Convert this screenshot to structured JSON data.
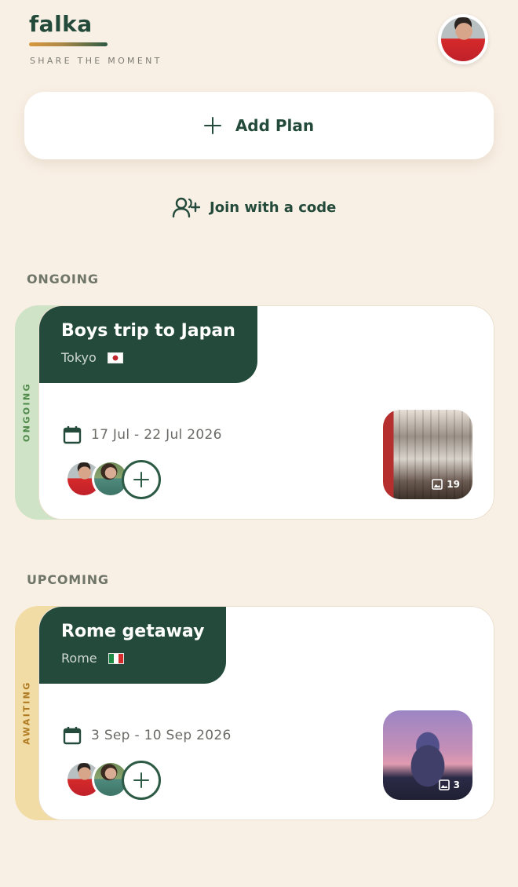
{
  "app": {
    "logo": "falka",
    "tagline": "SHARE THE MOMENT"
  },
  "actions": {
    "add_plan_label": "Add Plan",
    "join_label": "Join with a code"
  },
  "sections": {
    "ongoing_heading": "ONGOING",
    "upcoming_heading": "UPCOMING"
  },
  "plans": [
    {
      "status": "ONGOING",
      "status_color": "#cfe3c6",
      "status_text_color": "#4f8a4a",
      "title": "Boys trip to Japan",
      "location": "Tokyo",
      "flag": "japan-flag",
      "dates": "17 Jul - 22 Jul 2026",
      "photo_count": "19"
    },
    {
      "status": "AWAITING",
      "status_color": "#f0dca4",
      "status_text_color": "#b07a22",
      "title": "Rome getaway",
      "location": "Rome",
      "flag": "italy-flag",
      "dates": "3 Sep - 10 Sep 2026",
      "photo_count": "3"
    }
  ],
  "colors": {
    "background": "#f9f0e5",
    "brand_green": "#234a3a",
    "card_white": "#ffffff"
  }
}
